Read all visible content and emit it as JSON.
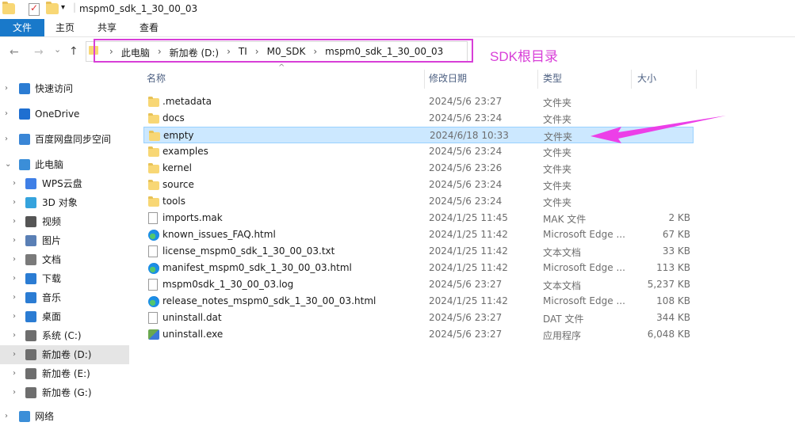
{
  "window": {
    "title": "mspm0_sdk_1_30_00_03"
  },
  "menu": {
    "file": "文件",
    "home": "主页",
    "share": "共享",
    "view": "查看"
  },
  "nav": {
    "back": "←",
    "forward": "→",
    "recent": "⌄",
    "up": "↑"
  },
  "breadcrumb": [
    "此电脑",
    "新加卷 (D:)",
    "TI",
    "M0_SDK",
    "mspm0_sdk_1_30_00_03"
  ],
  "annotation": {
    "label": "SDK根目录",
    "color": "#d83fd8"
  },
  "sidebar": {
    "items": [
      {
        "label": "快速访问",
        "icon": "star-icon",
        "color": "#2b7cd3"
      },
      {
        "label": "OneDrive",
        "icon": "cloud-icon",
        "color": "#1f6fd1"
      },
      {
        "label": "百度网盘同步空间",
        "icon": "baidu-icon",
        "color": "#3a86d6"
      },
      {
        "label": "此电脑",
        "icon": "computer-icon",
        "color": "#3b8ed8"
      },
      {
        "label": "WPS云盘",
        "icon": "wps-cloud-icon",
        "color": "#3f7fe6"
      },
      {
        "label": "3D 对象",
        "icon": "cube-icon",
        "color": "#35a3dd"
      },
      {
        "label": "视频",
        "icon": "video-icon",
        "color": "#555555"
      },
      {
        "label": "图片",
        "icon": "picture-icon",
        "color": "#5a7fb5"
      },
      {
        "label": "文档",
        "icon": "document-icon",
        "color": "#7a7a7a"
      },
      {
        "label": "下载",
        "icon": "download-icon",
        "color": "#2b7cd3"
      },
      {
        "label": "音乐",
        "icon": "music-icon",
        "color": "#2b7cd3"
      },
      {
        "label": "桌面",
        "icon": "desktop-icon",
        "color": "#2b7cd3"
      },
      {
        "label": "系统 (C:)",
        "icon": "drive-icon",
        "color": "#6e6e6e"
      },
      {
        "label": "新加卷 (D:)",
        "icon": "drive-icon",
        "color": "#6e6e6e"
      },
      {
        "label": "新加卷 (E:)",
        "icon": "drive-icon",
        "color": "#6e6e6e"
      },
      {
        "label": "新加卷 (G:)",
        "icon": "drive-icon",
        "color": "#6e6e6e"
      },
      {
        "label": "网络",
        "icon": "network-icon",
        "color": "#3b8ed8"
      }
    ]
  },
  "columns": {
    "name": "名称",
    "date": "修改日期",
    "type": "类型",
    "size": "大小"
  },
  "files": [
    {
      "name": ".metadata",
      "date": "2024/5/6 23:27",
      "type": "文件夹",
      "size": "",
      "icon": "folder-icon"
    },
    {
      "name": "docs",
      "date": "2024/5/6 23:24",
      "type": "文件夹",
      "size": "",
      "icon": "folder-icon"
    },
    {
      "name": "empty",
      "date": "2024/6/18 10:33",
      "type": "文件夹",
      "size": "",
      "icon": "folder-icon"
    },
    {
      "name": "examples",
      "date": "2024/5/6 23:24",
      "type": "文件夹",
      "size": "",
      "icon": "folder-icon"
    },
    {
      "name": "kernel",
      "date": "2024/5/6 23:26",
      "type": "文件夹",
      "size": "",
      "icon": "folder-icon"
    },
    {
      "name": "source",
      "date": "2024/5/6 23:24",
      "type": "文件夹",
      "size": "",
      "icon": "folder-icon"
    },
    {
      "name": "tools",
      "date": "2024/5/6 23:24",
      "type": "文件夹",
      "size": "",
      "icon": "folder-icon"
    },
    {
      "name": "imports.mak",
      "date": "2024/1/25 11:45",
      "type": "MAK 文件",
      "size": "2 KB",
      "icon": "file-icon"
    },
    {
      "name": "known_issues_FAQ.html",
      "date": "2024/1/25 11:42",
      "type": "Microsoft Edge ...",
      "size": "67 KB",
      "icon": "edge-icon"
    },
    {
      "name": "license_mspm0_sdk_1_30_00_03.txt",
      "date": "2024/1/25 11:42",
      "type": "文本文档",
      "size": "33 KB",
      "icon": "file-icon"
    },
    {
      "name": "manifest_mspm0_sdk_1_30_00_03.html",
      "date": "2024/1/25 11:42",
      "type": "Microsoft Edge ...",
      "size": "113 KB",
      "icon": "edge-icon"
    },
    {
      "name": "mspm0sdk_1_30_00_03.log",
      "date": "2024/5/6 23:27",
      "type": "文本文档",
      "size": "5,237 KB",
      "icon": "file-icon"
    },
    {
      "name": "release_notes_mspm0_sdk_1_30_00_03.html",
      "date": "2024/1/25 11:42",
      "type": "Microsoft Edge ...",
      "size": "108 KB",
      "icon": "edge-icon"
    },
    {
      "name": "uninstall.dat",
      "date": "2024/5/6 23:27",
      "type": "DAT 文件",
      "size": "344 KB",
      "icon": "file-icon"
    },
    {
      "name": "uninstall.exe",
      "date": "2024/5/6 23:27",
      "type": "应用程序",
      "size": "6,048 KB",
      "icon": "exe-icon"
    }
  ]
}
